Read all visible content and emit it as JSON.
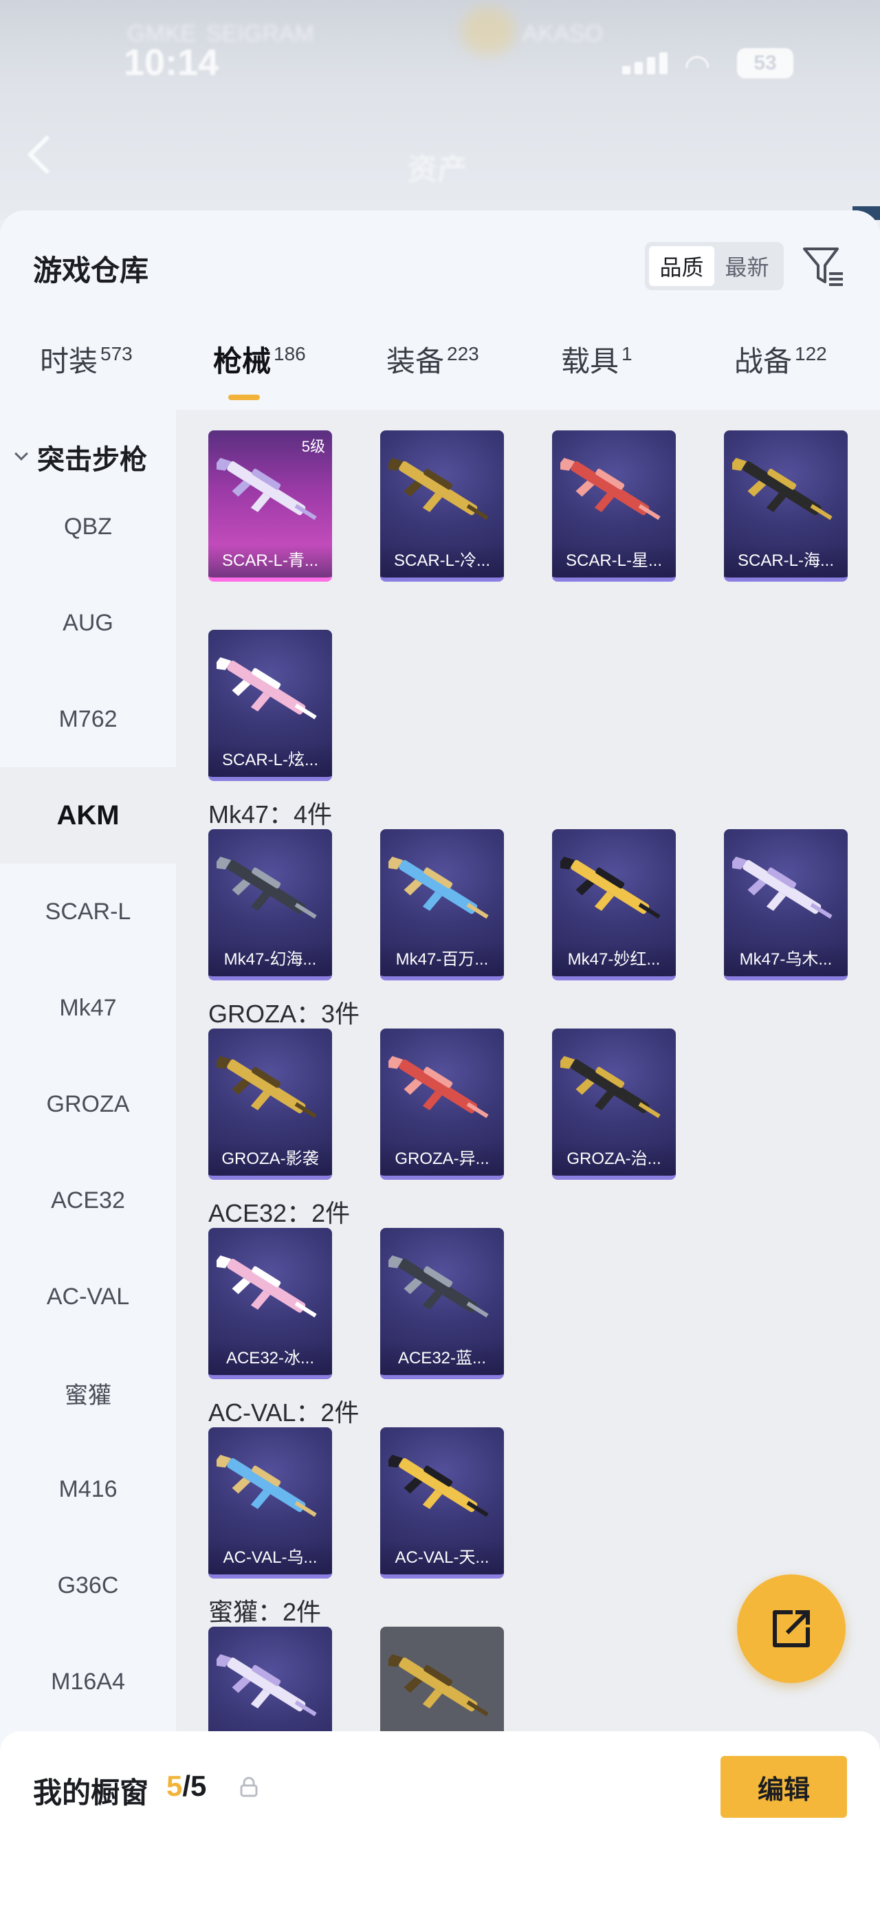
{
  "status_bar": {
    "time": "10:14",
    "battery": "53",
    "blurred_labels": [
      "GMKE",
      "SEIGRAM",
      "AKASO"
    ],
    "nav_title": "资产"
  },
  "header": {
    "title": "游戏仓库",
    "sort_options": [
      "品质",
      "最新"
    ],
    "sort_active": "品质"
  },
  "tabs": [
    {
      "label": "时装",
      "count": "573"
    },
    {
      "label": "枪械",
      "count": "186"
    },
    {
      "label": "装备",
      "count": "223"
    },
    {
      "label": "载具",
      "count": "1"
    },
    {
      "label": "战备",
      "count": "122"
    }
  ],
  "sidebar": {
    "category": "突击步枪",
    "items": [
      "QBZ",
      "AUG",
      "M762",
      "AKM",
      "SCAR-L",
      "Mk47",
      "GROZA",
      "ACE32",
      "AC-VAL",
      "蜜獾",
      "M416",
      "G36C",
      "M16A4"
    ],
    "active": "AKM"
  },
  "groups": [
    {
      "label": "",
      "cards": [
        {
          "name": "SCAR-L-青...",
          "level": "5级",
          "rarity": "pink"
        },
        {
          "name": "SCAR-L-冷...",
          "rarity": "purple"
        },
        {
          "name": "SCAR-L-星...",
          "rarity": "purple"
        },
        {
          "name": "SCAR-L-海...",
          "rarity": "purple"
        },
        {
          "name": "SCAR-L-炫...",
          "rarity": "purple"
        }
      ]
    },
    {
      "label": "Mk47：4件",
      "cards": [
        {
          "name": "Mk47-幻海...",
          "rarity": "purple"
        },
        {
          "name": "Mk47-百万...",
          "rarity": "purple"
        },
        {
          "name": "Mk47-妙红...",
          "rarity": "purple"
        },
        {
          "name": "Mk47-乌木...",
          "rarity": "purple"
        }
      ]
    },
    {
      "label": "GROZA：3件",
      "cards": [
        {
          "name": "GROZA-影袭",
          "rarity": "purple"
        },
        {
          "name": "GROZA-异...",
          "rarity": "purple"
        },
        {
          "name": "GROZA-治...",
          "rarity": "purple"
        }
      ]
    },
    {
      "label": "ACE32：2件",
      "cards": [
        {
          "name": "ACE32-冰...",
          "rarity": "purple"
        },
        {
          "name": "ACE32-蓝...",
          "rarity": "purple"
        }
      ]
    },
    {
      "label": "AC-VAL：2件",
      "cards": [
        {
          "name": "AC-VAL-乌...",
          "rarity": "purple"
        },
        {
          "name": "AC-VAL-天...",
          "rarity": "purple"
        }
      ]
    },
    {
      "label": "蜜獾：2件",
      "cards": [
        {
          "name": "",
          "rarity": "purple"
        },
        {
          "name": "",
          "rarity": "gray"
        }
      ]
    }
  ],
  "showcase": {
    "label": "我的橱窗",
    "current": "5",
    "separator": "/",
    "max": "5",
    "edit_label": "编辑"
  },
  "colors": {
    "accent": "#f4b73a",
    "card_purple": "#3a3776",
    "card_pink": "#d955c6",
    "background": "#eceef2"
  },
  "icons": [
    "back-icon",
    "filter-icon",
    "chevron-down-icon",
    "share-icon",
    "lock-icon"
  ]
}
